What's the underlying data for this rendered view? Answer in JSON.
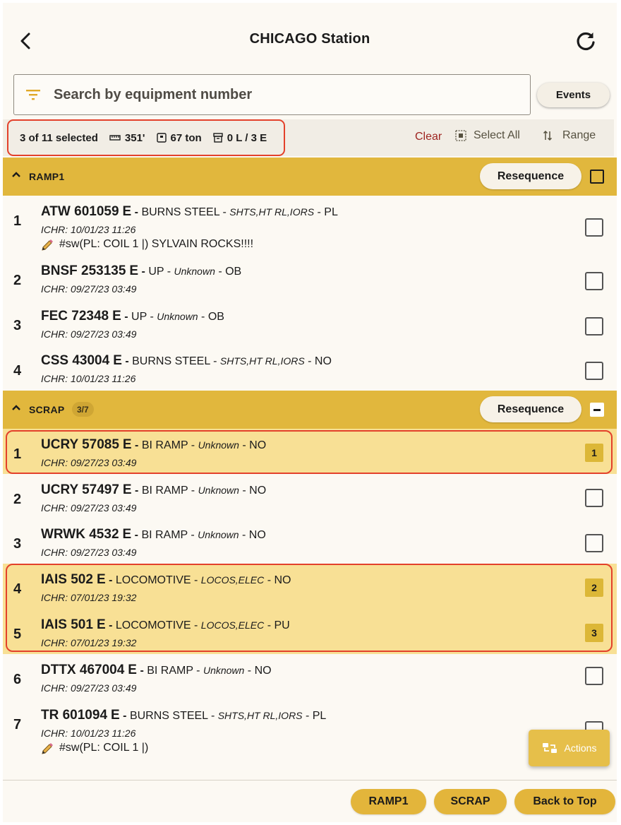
{
  "header": {
    "title": "CHICAGO Station",
    "back_icon": "chevron-left-icon",
    "refresh_icon": "refresh-icon"
  },
  "search": {
    "placeholder": "Search by equipment number",
    "value": "",
    "icon": "filter-icon"
  },
  "events_button": "Events",
  "summary": {
    "selected": "3 of 11 selected",
    "length": "351'",
    "weight": "67 ton",
    "loads": "0 L / 3 E",
    "clear": "Clear",
    "select_all": "Select All",
    "range": "Range"
  },
  "groups": [
    {
      "name": "RAMP1",
      "count": "",
      "resequence": "Resequence",
      "check_state": "unchecked",
      "rows": [
        {
          "num": "1",
          "equipment": "ATW 601059",
          "status": "E",
          "consignee": "BURNS STEEL",
          "commodity": "SHTS,HT RL,IORS",
          "code": "PL",
          "date": "ICHR: 10/01/23 11:26",
          "note": "#sw(PL: COIL 1 |) SYLVAIN ROCKS!!!!",
          "selected": false,
          "order": ""
        },
        {
          "num": "2",
          "equipment": "BNSF 253135",
          "status": "E",
          "consignee": "UP",
          "commodity": "Unknown",
          "code": "OB",
          "date": "ICHR: 09/27/23 03:49",
          "note": "",
          "selected": false,
          "order": ""
        },
        {
          "num": "3",
          "equipment": "FEC 72348",
          "status": "E",
          "consignee": "UP",
          "commodity": "Unknown",
          "code": "OB",
          "date": "ICHR: 09/27/23 03:49",
          "note": "",
          "selected": false,
          "order": ""
        },
        {
          "num": "4",
          "equipment": "CSS 43004",
          "status": "E",
          "consignee": "BURNS STEEL",
          "commodity": "SHTS,HT RL,IORS",
          "code": "NO",
          "date": "ICHR: 10/01/23 11:26",
          "note": "",
          "selected": false,
          "order": ""
        }
      ]
    },
    {
      "name": "SCRAP",
      "count": "3/7",
      "resequence": "Resequence",
      "check_state": "partial",
      "rows": [
        {
          "num": "1",
          "equipment": "UCRY 57085",
          "status": "E",
          "consignee": "BI RAMP",
          "commodity": "Unknown",
          "code": "NO",
          "date": "ICHR: 09/27/23 03:49",
          "note": "",
          "selected": true,
          "order": "1"
        },
        {
          "num": "2",
          "equipment": "UCRY 57497",
          "status": "E",
          "consignee": "BI RAMP",
          "commodity": "Unknown",
          "code": "NO",
          "date": "ICHR: 09/27/23 03:49",
          "note": "",
          "selected": false,
          "order": ""
        },
        {
          "num": "3",
          "equipment": "WRWK 4532",
          "status": "E",
          "consignee": "BI RAMP",
          "commodity": "Unknown",
          "code": "NO",
          "date": "ICHR: 09/27/23 03:49",
          "note": "",
          "selected": false,
          "order": ""
        },
        {
          "num": "4",
          "equipment": "IAIS 502",
          "status": "E",
          "consignee": "LOCOMOTIVE",
          "commodity": "LOCOS,ELEC",
          "code": "NO",
          "date": "ICHR: 07/01/23 19:32",
          "note": "",
          "selected": true,
          "order": "2"
        },
        {
          "num": "5",
          "equipment": "IAIS 501",
          "status": "E",
          "consignee": "LOCOMOTIVE",
          "commodity": "LOCOS,ELEC",
          "code": "PU",
          "date": "ICHR: 07/01/23 19:32",
          "note": "",
          "selected": true,
          "order": "3"
        },
        {
          "num": "6",
          "equipment": "DTTX 467004",
          "status": "E",
          "consignee": "BI RAMP",
          "commodity": "Unknown",
          "code": "NO",
          "date": "ICHR: 09/27/23 03:49",
          "note": "",
          "selected": false,
          "order": ""
        },
        {
          "num": "7",
          "equipment": "TR 601094",
          "status": "E",
          "consignee": "BURNS STEEL",
          "commodity": "SHTS,HT RL,IORS",
          "code": "PL",
          "date": "ICHR: 10/01/23 11:26",
          "note": "#sw(PL: COIL 1 |)",
          "selected": false,
          "order": ""
        }
      ]
    }
  ],
  "actions_button": "Actions",
  "footer": {
    "buttons": [
      "RAMP1",
      "SCRAP",
      "Back to Top"
    ]
  },
  "colors": {
    "accent": "#e1b73d",
    "selected_row": "#f8e095",
    "highlight_outline": "#e3412b",
    "clear_text": "#9e2420",
    "background": "#fcf9f3"
  }
}
